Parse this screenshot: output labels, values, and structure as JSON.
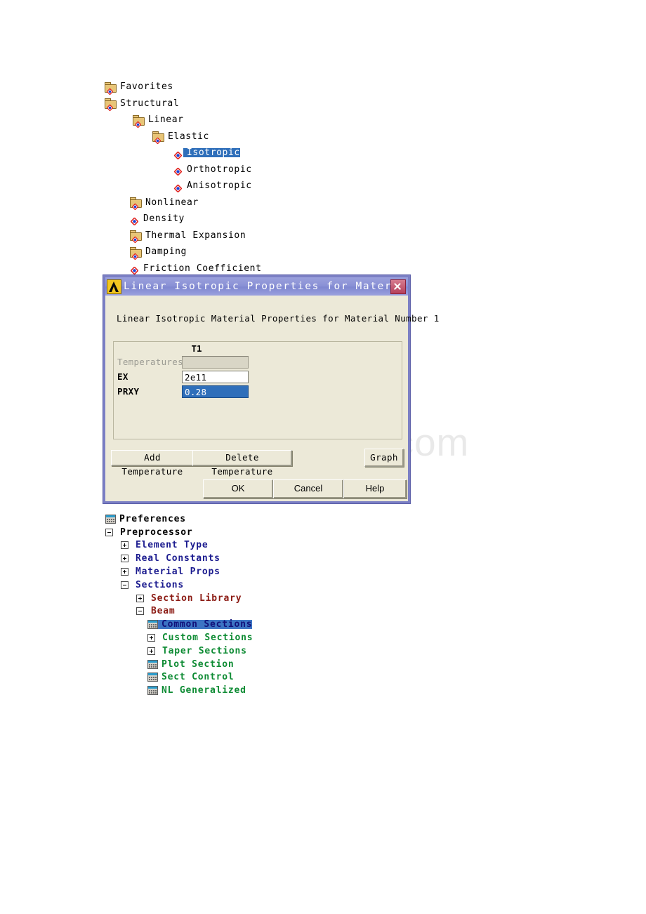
{
  "watermark": "www.bdocx.com",
  "material_tree": {
    "items": [
      {
        "label": "Favorites",
        "icon": "folder-node-icon",
        "indent": 1,
        "selected": false
      },
      {
        "label": "Structural",
        "icon": "folder-node-icon",
        "indent": 1,
        "selected": false
      },
      {
        "label": "Linear",
        "icon": "folder-node-icon",
        "indent": 2,
        "selected": false
      },
      {
        "label": "Elastic",
        "icon": "folder-node-icon",
        "indent": 3,
        "selected": false
      },
      {
        "label": "Isotropic",
        "icon": "diamond-node-icon",
        "indent": 4,
        "selected": true
      },
      {
        "label": "Orthotropic",
        "icon": "diamond-node-icon",
        "indent": 4,
        "selected": false
      },
      {
        "label": "Anisotropic",
        "icon": "diamond-node-icon",
        "indent": 4,
        "selected": false
      },
      {
        "label": "Nonlinear",
        "icon": "folder-node-icon",
        "indent": 5,
        "selected": false
      },
      {
        "label": "Density",
        "icon": "diamond-node-icon",
        "indent": 5,
        "selected": false
      },
      {
        "label": "Thermal Expansion",
        "icon": "folder-node-icon",
        "indent": 5,
        "selected": false
      },
      {
        "label": "Damping",
        "icon": "folder-node-icon",
        "indent": 5,
        "selected": false
      },
      {
        "label": "Friction Coefficient",
        "icon": "diamond-node-icon",
        "indent": 5,
        "selected": false
      }
    ]
  },
  "dialog": {
    "title": "Linear Isotropic Properties for Mater...",
    "logo": "ansys-logo-icon",
    "close": "close-icon",
    "heading": "Linear Isotropic Material Properties for Material Number 1",
    "column_header": "T1",
    "rows": [
      {
        "label": "Temperatures",
        "value": "",
        "state": "disabled"
      },
      {
        "label": "EX",
        "value": "2e11",
        "state": "normal"
      },
      {
        "label": "PRXY",
        "value": "0.28",
        "state": "selected"
      }
    ],
    "buttons": {
      "add_temperature": "Add Temperature",
      "delete_temperature": "Delete Temperature",
      "graph": "Graph",
      "ok": "OK",
      "cancel": "Cancel",
      "help": "Help"
    }
  },
  "menu_tree": {
    "items": [
      {
        "label": "Preferences",
        "marker": "none",
        "icon": "dialog-icon",
        "level": 0,
        "color": "c-black",
        "selected": false
      },
      {
        "label": "Preprocessor",
        "marker": "minus",
        "icon": "none",
        "level": 0,
        "color": "c-black",
        "selected": false
      },
      {
        "label": "Element Type",
        "marker": "plus",
        "icon": "none",
        "level": 1,
        "color": "c-blue",
        "selected": false
      },
      {
        "label": "Real Constants",
        "marker": "plus",
        "icon": "none",
        "level": 1,
        "color": "c-blue",
        "selected": false
      },
      {
        "label": "Material Props",
        "marker": "plus",
        "icon": "none",
        "level": 1,
        "color": "c-blue",
        "selected": false
      },
      {
        "label": "Sections",
        "marker": "minus",
        "icon": "none",
        "level": 1,
        "color": "c-blue",
        "selected": false
      },
      {
        "label": "Section Library",
        "marker": "plus",
        "icon": "none",
        "level": 2,
        "color": "c-red",
        "selected": false
      },
      {
        "label": "Beam",
        "marker": "minus",
        "icon": "none",
        "level": 2,
        "color": "c-red",
        "selected": false
      },
      {
        "label": "Common Sections",
        "marker": "none",
        "icon": "dialog-icon",
        "level": 3,
        "color": "c-green",
        "selected": true
      },
      {
        "label": "Custom Sections",
        "marker": "plus",
        "icon": "none",
        "level": 3,
        "color": "c-green",
        "selected": false
      },
      {
        "label": "Taper Sections",
        "marker": "plus",
        "icon": "none",
        "level": 3,
        "color": "c-green",
        "selected": false
      },
      {
        "label": "Plot Section",
        "marker": "none",
        "icon": "dialog-icon",
        "level": 3,
        "color": "c-green",
        "selected": false
      },
      {
        "label": "Sect Control",
        "marker": "none",
        "icon": "dialog-icon",
        "level": 3,
        "color": "c-green",
        "selected": false
      },
      {
        "label": "NL Generalized",
        "marker": "none",
        "icon": "dialog-icon",
        "level": 3,
        "color": "c-green",
        "selected": false
      }
    ]
  },
  "colors": {
    "selection_blue": "#2f6fba",
    "dialog_face": "#ece9d8",
    "dialog_border": "#7b7fc4",
    "menu_blue": "#1b1b8f",
    "menu_red": "#8b1a13",
    "menu_green": "#0d8b33",
    "ansys_gold": "#f3c620"
  }
}
